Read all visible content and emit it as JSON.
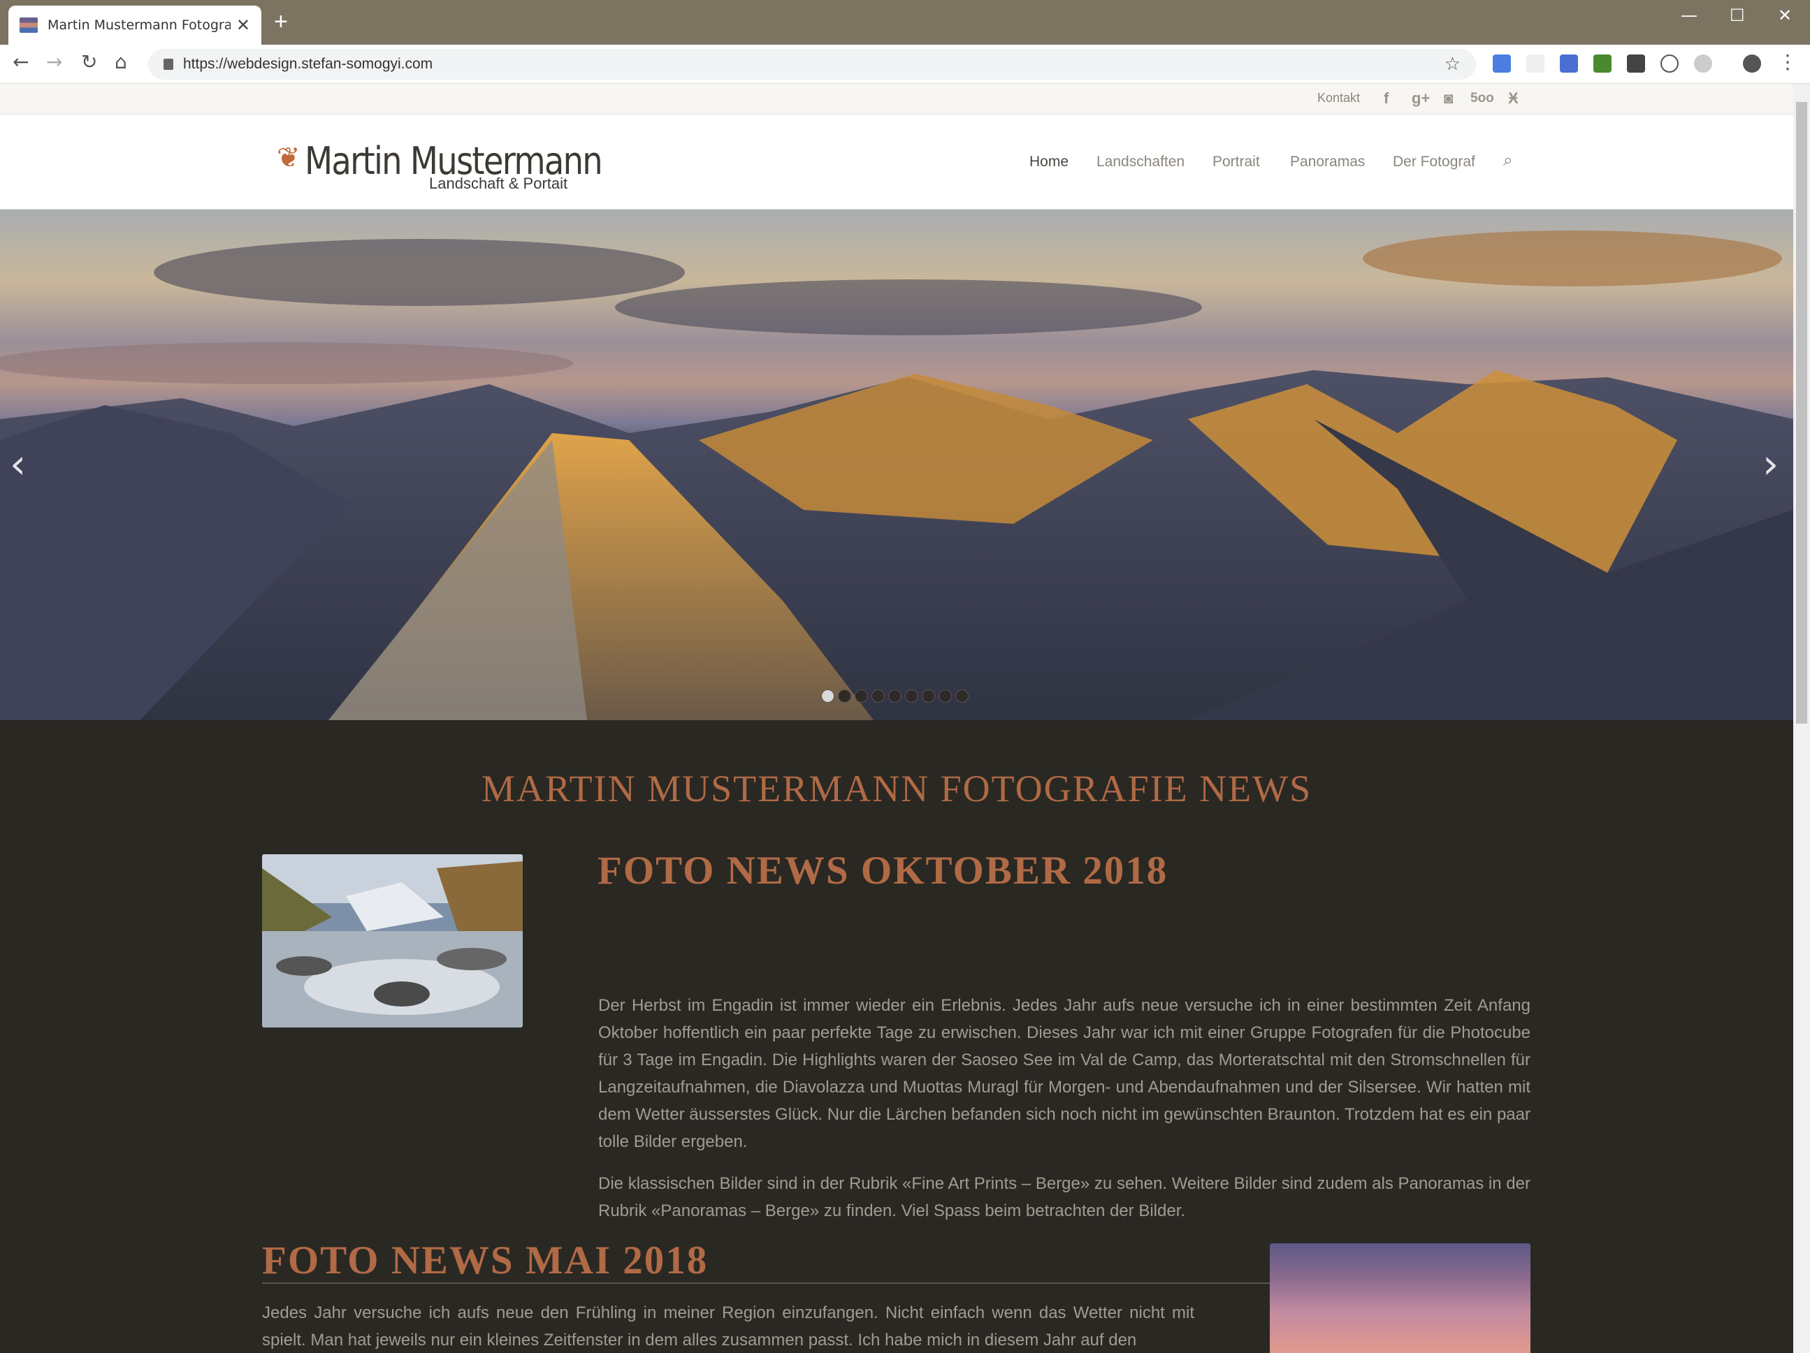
{
  "browser": {
    "tab_title": "Martin Mustermann Fotografie –",
    "new_tab": "+",
    "close_tab": "✕",
    "url": "https://webdesign.stefan-somogyi.com",
    "win_min": "—",
    "win_max": "☐",
    "win_close": "✕",
    "back": "←",
    "forward": "→",
    "reload": "↻",
    "home": "⌂",
    "star": "☆",
    "menu": "⋮"
  },
  "topbar": {
    "kontakt": "Kontakt",
    "social": [
      "f",
      "g+",
      "◙",
      "5oo",
      "Ӿ"
    ]
  },
  "header": {
    "logo_name": "Martin Mustermann",
    "logo_sub": "Landschaft & Portait",
    "menu": [
      "Home",
      "Landschaften",
      "Portrait",
      "Panoramas",
      "Der Fotograf"
    ],
    "search_icon": "⌕"
  },
  "slider": {
    "prev": "‹",
    "next": "›",
    "dots": 9,
    "active_dot": 1
  },
  "main": {
    "section_title": "MARTIN MUSTERMANN FOTOGRAFIE NEWS",
    "posts": [
      {
        "title": "FOTO NEWS OKTOBER 2018",
        "p1": "Der Herbst im Engadin ist immer wieder ein Erlebnis. Jedes Jahr aufs neue versuche ich in einer bestimmten Zeit Anfang Oktober hoffentlich ein paar perfekte Tage zu erwischen. Dieses Jahr war ich mit einer Gruppe Fotografen für die Photocube für 3 Tage im Engadin. Die Highlights waren der Saoseo See im Val de Camp, das Morteratschtal mit den Stromschnellen für Langzeitaufnahmen, die Diavolazza und Muottas Muragl für Morgen- und Abendaufnahmen und der Silsersee. Wir hatten mit dem Wetter äusserstes Glück. Nur die Lärchen befanden sich noch nicht im gewünschten Braunton. Trotzdem hat es ein paar tolle Bilder ergeben.",
        "p2": "Die klassischen Bilder sind in der Rubrik «Fine Art Prints – Berge» zu sehen. Weitere Bilder sind zudem als Panoramas in der Rubrik «Panoramas – Berge» zu finden. Viel Spass beim betrachten der Bilder."
      },
      {
        "title": "FOTO NEWS MAI 2018",
        "p1": "Jedes Jahr versuche ich aufs neue den Frühling in meiner Region einzufangen. Nicht einfach wenn das Wetter nicht mit spielt. Man hat jeweils nur ein kleines Zeitfenster in dem alles zusammen passt. Ich habe mich in diesem Jahr auf den"
      }
    ]
  }
}
